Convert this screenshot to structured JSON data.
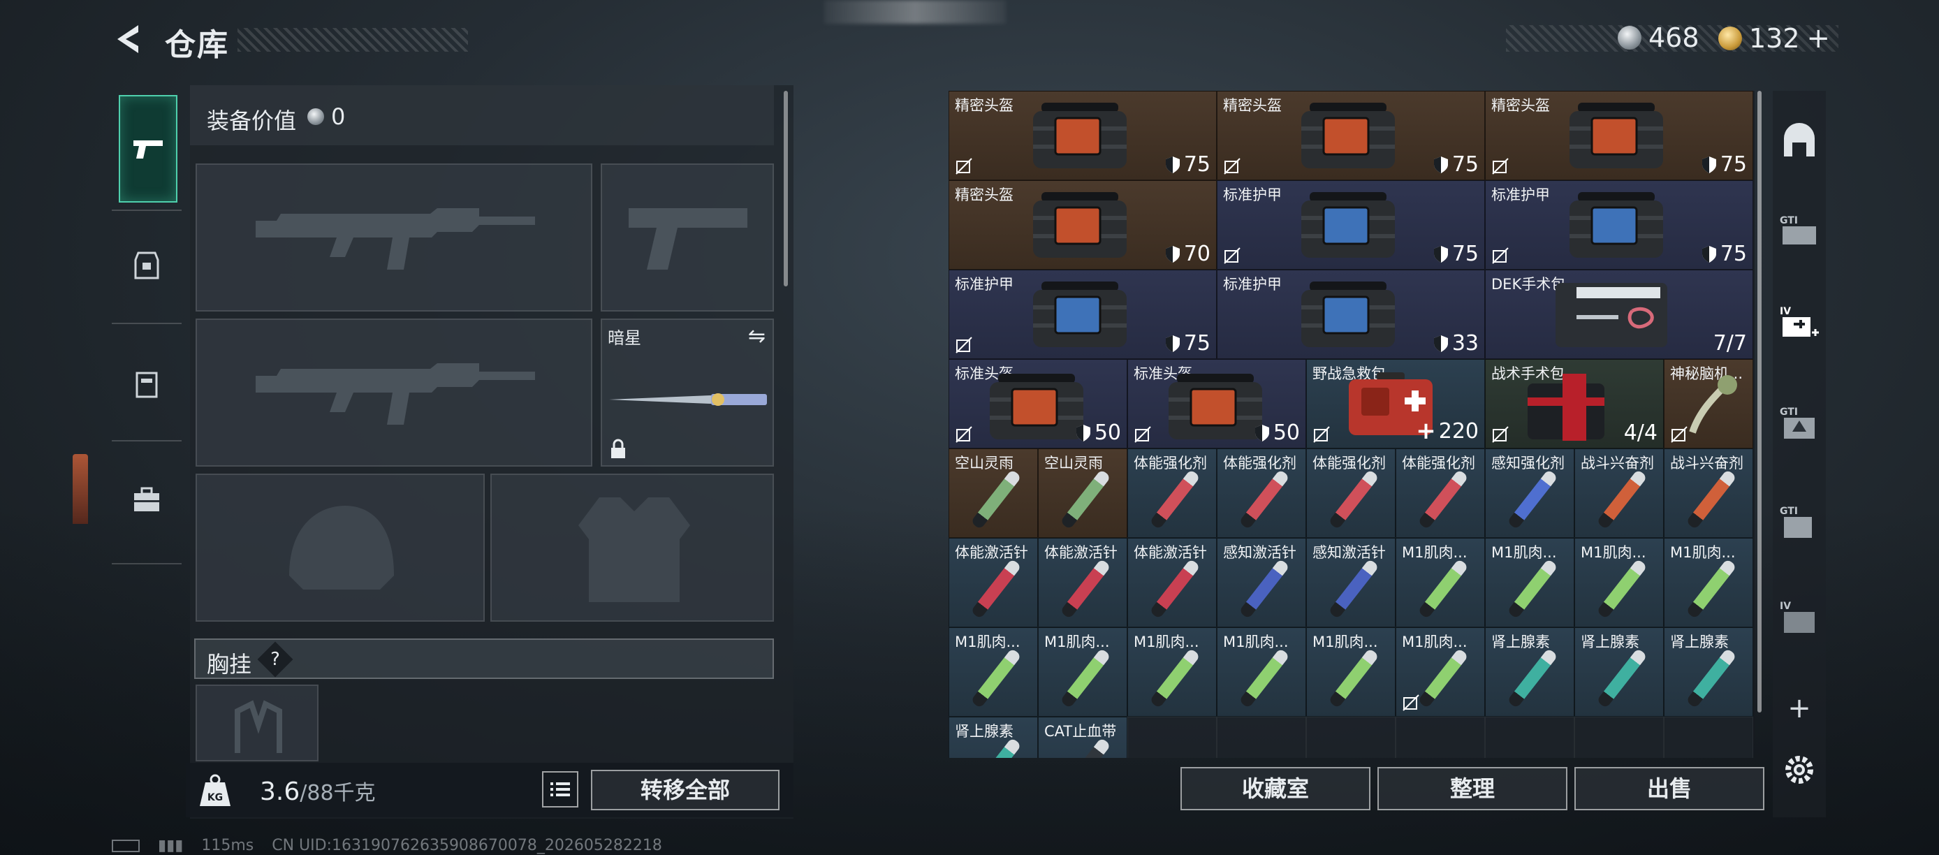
{
  "header": {
    "title": "仓库",
    "currency_silver": "468",
    "currency_gold": "132",
    "plus_label": "+"
  },
  "equipment": {
    "value_label": "装备价值",
    "value": "0",
    "melee_name": "暗星",
    "chest_label": "胸挂",
    "chest_help": "?"
  },
  "weight": {
    "current": "3.6",
    "limit": "/88千克"
  },
  "buttons": {
    "transfer_all": "转移全部",
    "collection": "收藏室",
    "organize": "整理",
    "sell": "出售"
  },
  "inventory": {
    "rows": [
      [
        {
          "name": "精密头盔",
          "value": "75",
          "bg": "brown",
          "kind": "helmet",
          "nostack": true
        },
        {
          "name": "精密头盔",
          "value": "75",
          "bg": "brown",
          "kind": "helmet",
          "nostack": true
        },
        {
          "name": "精密头盔",
          "value": "75",
          "bg": "brown",
          "kind": "helmet",
          "nostack": true
        }
      ],
      [
        {
          "name": "精密头盔",
          "value": "70",
          "bg": "brown",
          "kind": "helmet",
          "nostack": false
        },
        {
          "name": "标准护甲",
          "value": "75",
          "bg": "navy",
          "kind": "armor",
          "nostack": true
        },
        {
          "name": "标准护甲",
          "value": "75",
          "bg": "navy",
          "kind": "armor",
          "nostack": true
        }
      ],
      [
        {
          "name": "标准护甲",
          "value": "75",
          "bg": "navy",
          "kind": "armor",
          "nostack": true
        },
        {
          "name": "标准护甲",
          "value": "33",
          "bg": "navy",
          "kind": "armor",
          "nostack": false
        },
        {
          "name": "DEK手术包",
          "value": "7/7",
          "bg": "navy",
          "kind": "kit",
          "nostack": false
        }
      ]
    ],
    "row4": [
      {
        "name": "标准头盔",
        "value": "50",
        "bg": "navy",
        "kind": "helmet"
      },
      {
        "name": "标准头盔",
        "value": "50",
        "bg": "navy",
        "kind": "helmet"
      },
      {
        "name": "野战急救包",
        "value": "220",
        "bg": "slate",
        "kind": "medbox"
      },
      {
        "name": "战术手术包",
        "value": "4/4",
        "bg": "green",
        "kind": "kit2"
      },
      {
        "name": "神秘脑机...",
        "value": "",
        "bg": "brown",
        "kind": "brain"
      }
    ],
    "small_rows": [
      [
        {
          "name": "空山灵雨",
          "c": "#7fb07a",
          "bg": "brown"
        },
        {
          "name": "空山灵雨",
          "c": "#7fb07a",
          "bg": "brown"
        },
        {
          "name": "体能强化剂",
          "c": "#d0505a",
          "bg": "slate"
        },
        {
          "name": "体能强化剂",
          "c": "#d0505a",
          "bg": "slate"
        },
        {
          "name": "体能强化剂",
          "c": "#d0505a",
          "bg": "slate"
        },
        {
          "name": "体能强化剂",
          "c": "#d0505a",
          "bg": "slate"
        },
        {
          "name": "感知强化剂",
          "c": "#4f6fd0",
          "bg": "slate"
        },
        {
          "name": "战斗兴奋剂",
          "c": "#d0603a",
          "bg": "slate"
        },
        {
          "name": "战斗兴奋剂",
          "c": "#d0603a",
          "bg": "slate"
        }
      ],
      [
        {
          "name": "体能激活针",
          "c": "#c94052",
          "bg": "slate"
        },
        {
          "name": "体能激活针",
          "c": "#c94052",
          "bg": "slate"
        },
        {
          "name": "体能激活针",
          "c": "#c94052",
          "bg": "slate"
        },
        {
          "name": "感知激活针",
          "c": "#4a62c0",
          "bg": "slate"
        },
        {
          "name": "感知激活针",
          "c": "#4a62c0",
          "bg": "slate"
        },
        {
          "name": "M1肌肉...",
          "c": "#8fd070",
          "bg": "slate"
        },
        {
          "name": "M1肌肉...",
          "c": "#8fd070",
          "bg": "slate"
        },
        {
          "name": "M1肌肉...",
          "c": "#8fd070",
          "bg": "slate"
        },
        {
          "name": "M1肌肉...",
          "c": "#8fd070",
          "bg": "slate"
        }
      ],
      [
        {
          "name": "M1肌肉...",
          "c": "#8fd070",
          "bg": "slate"
        },
        {
          "name": "M1肌肉...",
          "c": "#8fd070",
          "bg": "slate"
        },
        {
          "name": "M1肌肉...",
          "c": "#8fd070",
          "bg": "slate"
        },
        {
          "name": "M1肌肉...",
          "c": "#8fd070",
          "bg": "slate"
        },
        {
          "name": "M1肌肉...",
          "c": "#8fd070",
          "bg": "slate"
        },
        {
          "name": "M1肌肉...",
          "c": "#8fd070",
          "bg": "slate"
        },
        {
          "name": "肾上腺素",
          "c": "#3fb0a0",
          "bg": "slate"
        },
        {
          "name": "肾上腺素",
          "c": "#3fb0a0",
          "bg": "slate"
        },
        {
          "name": "肾上腺素",
          "c": "#3fb0a0",
          "bg": "slate"
        }
      ],
      [
        {
          "name": "肾上腺素",
          "c": "#3fb0a0",
          "bg": "slate"
        },
        {
          "name": "CAT止血带",
          "c": "#30363c",
          "bg": "slate"
        }
      ]
    ]
  },
  "rail_icons": [
    "home-icon",
    "gti-card-icon",
    "iv-medkit-icon",
    "gti-upgrade-icon",
    "gti-bag-icon",
    "iv-case-icon"
  ],
  "status_bar": {
    "ping": "115ms",
    "uid": "CN UID:1631907626359086700​78_202605282218"
  },
  "colors": {
    "accent": "#4fd0ad",
    "brown": "#4b3a2c",
    "navy": "#2f3550",
    "slate": "#2c4050"
  }
}
